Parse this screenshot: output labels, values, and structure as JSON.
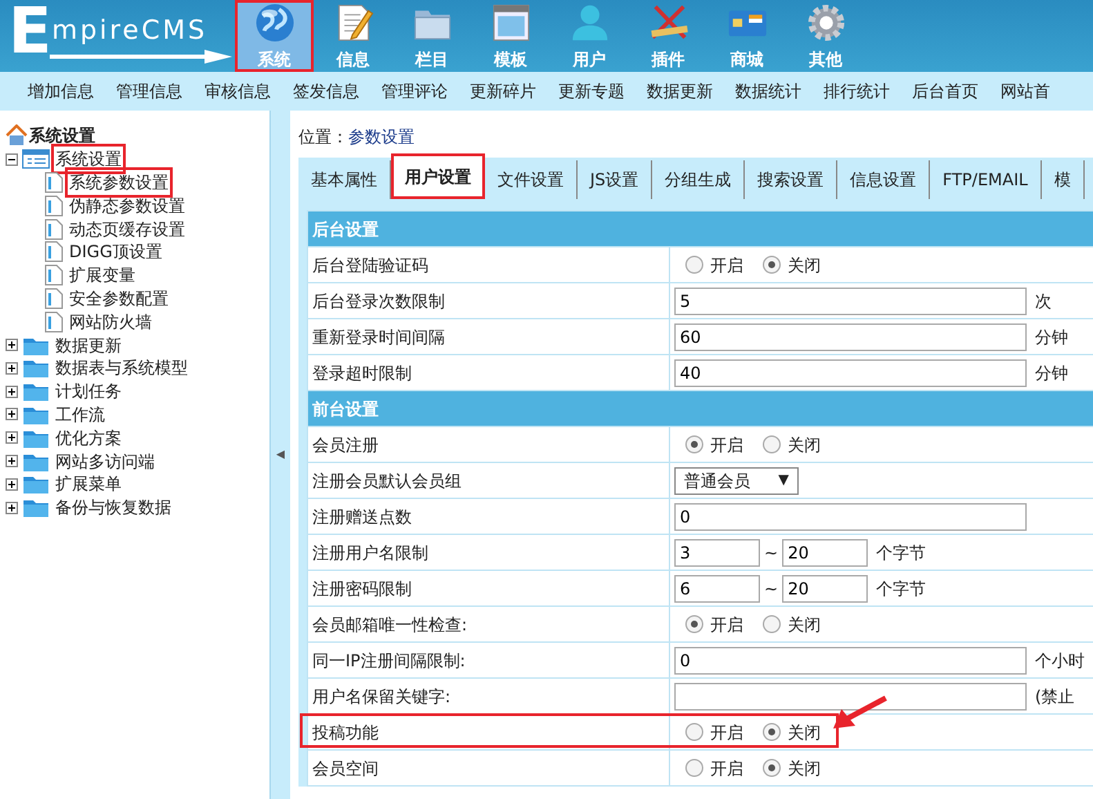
{
  "logo": {
    "initial": "E",
    "rest": "mpireCMS"
  },
  "top_nav": [
    {
      "label": "系统",
      "kind": "globe",
      "selected": true,
      "highlighted": true
    },
    {
      "label": "信息",
      "kind": "document",
      "selected": false,
      "highlighted": false
    },
    {
      "label": "栏目",
      "kind": "folder",
      "selected": false,
      "highlighted": false
    },
    {
      "label": "模板",
      "kind": "window",
      "selected": false,
      "highlighted": false
    },
    {
      "label": "用户",
      "kind": "person",
      "selected": false,
      "highlighted": false
    },
    {
      "label": "插件",
      "kind": "tools",
      "selected": false,
      "highlighted": false
    },
    {
      "label": "商城",
      "kind": "card",
      "selected": false,
      "highlighted": false
    },
    {
      "label": "其他",
      "kind": "gear",
      "selected": false,
      "highlighted": false
    }
  ],
  "sub_menu": [
    "增加信息",
    "管理信息",
    "审核信息",
    "签发信息",
    "管理评论",
    "更新碎片",
    "更新专题",
    "数据更新",
    "数据统计",
    "排行统计",
    "后台首页",
    "网站首"
  ],
  "sidebar": {
    "title": "系统设置",
    "tree": [
      {
        "label": "系统设置",
        "kind": "folder",
        "expanded": true,
        "highlighted": true,
        "children": [
          {
            "label": "系统参数设置",
            "kind": "page",
            "highlighted": true
          },
          {
            "label": "伪静态参数设置",
            "kind": "page",
            "highlighted": false
          },
          {
            "label": "动态页缓存设置",
            "kind": "page",
            "highlighted": false
          },
          {
            "label": "DIGG顶设置",
            "kind": "page",
            "highlighted": false
          },
          {
            "label": "扩展变量",
            "kind": "page",
            "highlighted": false
          },
          {
            "label": "安全参数配置",
            "kind": "page",
            "highlighted": false
          },
          {
            "label": "网站防火墙",
            "kind": "page",
            "highlighted": false
          }
        ]
      },
      {
        "label": "数据更新",
        "kind": "folder",
        "expanded": false,
        "highlighted": false
      },
      {
        "label": "数据表与系统模型",
        "kind": "folder",
        "expanded": false,
        "highlighted": false
      },
      {
        "label": "计划任务",
        "kind": "folder",
        "expanded": false,
        "highlighted": false
      },
      {
        "label": "工作流",
        "kind": "folder",
        "expanded": false,
        "highlighted": false
      },
      {
        "label": "优化方案",
        "kind": "folder",
        "expanded": false,
        "highlighted": false
      },
      {
        "label": "网站多访问端",
        "kind": "folder",
        "expanded": false,
        "highlighted": false
      },
      {
        "label": "扩展菜单",
        "kind": "folder",
        "expanded": false,
        "highlighted": false
      },
      {
        "label": "备份与恢复数据",
        "kind": "folder",
        "expanded": false,
        "highlighted": false
      }
    ]
  },
  "splitter": {
    "glyph": "◀"
  },
  "breadcrumb": {
    "label": "位置：",
    "link": "参数设置"
  },
  "tabs": [
    {
      "label": "基本属性",
      "selected": false,
      "highlighted": false
    },
    {
      "label": "用户设置",
      "selected": true,
      "highlighted": true
    },
    {
      "label": "文件设置",
      "selected": false,
      "highlighted": false
    },
    {
      "label": "JS设置",
      "selected": false,
      "highlighted": false
    },
    {
      "label": "分组生成",
      "selected": false,
      "highlighted": false
    },
    {
      "label": "搜索设置",
      "selected": false,
      "highlighted": false
    },
    {
      "label": "信息设置",
      "selected": false,
      "highlighted": false
    },
    {
      "label": "FTP/EMAIL",
      "selected": false,
      "highlighted": false
    },
    {
      "label": "模",
      "selected": false,
      "highlighted": false
    }
  ],
  "sections": [
    {
      "title": "后台设置",
      "rows": [
        {
          "label": "后台登陆验证码",
          "kind": "radio",
          "options": [
            {
              "label": "开启",
              "selected": false
            },
            {
              "label": "关闭",
              "selected": true
            }
          ]
        },
        {
          "label": "后台登录次数限制",
          "kind": "text",
          "value": "5",
          "suffix": "次"
        },
        {
          "label": "重新登录时间间隔",
          "kind": "text",
          "value": "60",
          "suffix": "分钟"
        },
        {
          "label": "登录超时限制",
          "kind": "text",
          "value": "40",
          "suffix": "分钟"
        }
      ]
    },
    {
      "title": "前台设置",
      "rows": [
        {
          "label": "会员注册",
          "kind": "radio",
          "options": [
            {
              "label": "开启",
              "selected": true
            },
            {
              "label": "关闭",
              "selected": false
            }
          ]
        },
        {
          "label": "注册会员默认会员组",
          "kind": "select",
          "value": "普通会员",
          "caret": "▼"
        },
        {
          "label": "注册赠送点数",
          "kind": "text",
          "value": "0"
        },
        {
          "label": "注册用户名限制",
          "kind": "range",
          "min": "3",
          "separator": "~",
          "max": "20",
          "suffix": "个字节"
        },
        {
          "label": "注册密码限制",
          "kind": "range",
          "min": "6",
          "separator": "~",
          "max": "20",
          "suffix": "个字节"
        },
        {
          "label": "会员邮箱唯一性检查:",
          "kind": "radio",
          "options": [
            {
              "label": "开启",
              "selected": true
            },
            {
              "label": "关闭",
              "selected": false
            }
          ]
        },
        {
          "label": "同一IP注册间隔限制:",
          "kind": "text",
          "value": "0",
          "suffix": "个小时"
        },
        {
          "label": "用户名保留关键字:",
          "kind": "text",
          "suffix": "(禁止"
        },
        {
          "label": "投稿功能",
          "kind": "radio",
          "highlighted": true,
          "pointer_arrow": true,
          "options": [
            {
              "label": "开启",
              "selected": false
            },
            {
              "label": "关闭",
              "selected": true
            }
          ]
        },
        {
          "label": "会员空间",
          "kind": "radio",
          "options": [
            {
              "label": "开启",
              "selected": false
            },
            {
              "label": "关闭",
              "selected": true
            }
          ]
        }
      ]
    }
  ]
}
